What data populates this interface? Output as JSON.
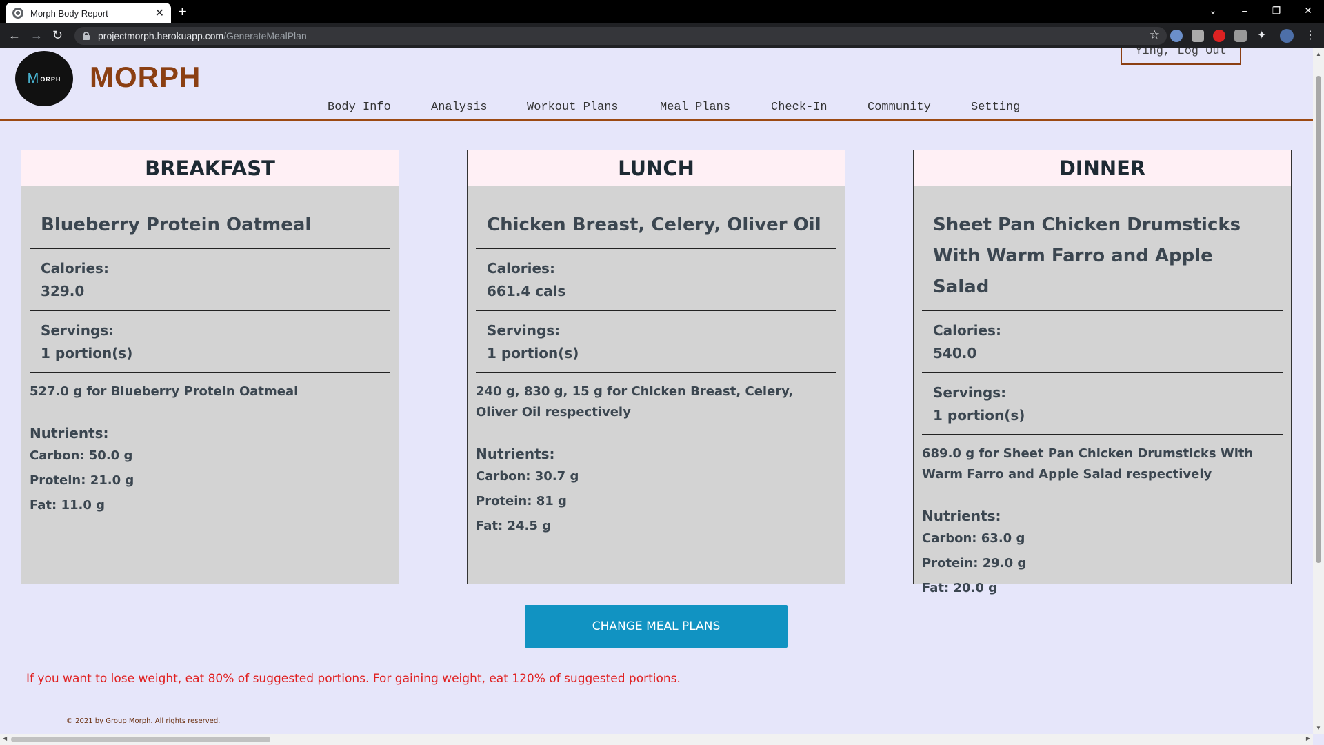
{
  "browser": {
    "tab_title": "Morph Body Report",
    "tab_close": "✕",
    "new_tab": "+",
    "url_host": "projectmorph.herokuapp.com",
    "url_path": "/GenerateMealPlan",
    "back": "←",
    "forward": "→",
    "reload": "↻",
    "star": "☆",
    "win_dropdown": "⌄",
    "win_minimize": "–",
    "win_restore": "❐",
    "win_close": "✕"
  },
  "header": {
    "logo_m": "M",
    "logo_rest": "ORPH",
    "brand": "MORPH",
    "logout": "Ying, Log Out",
    "menu": [
      "Body Info",
      "Analysis",
      "Workout Plans",
      "Meal Plans",
      "Check-In",
      "Community",
      "Setting"
    ]
  },
  "meals": [
    {
      "title": "BREAKFAST",
      "dish": "Blueberry Protein Oatmeal",
      "calories_label": "Calories:",
      "calories": "329.0",
      "servings_label": "Servings:",
      "servings": "1 portion(s)",
      "amount": "527.0 g for Blueberry Protein Oatmeal",
      "nutrients_label": "Nutrients:",
      "carbon": "Carbon: 50.0 g",
      "protein": "Protein: 21.0 g",
      "fat": "Fat: 11.0 g"
    },
    {
      "title": "LUNCH",
      "dish": "Chicken Breast, Celery, Oliver Oil",
      "calories_label": "Calories:",
      "calories": "661.4 cals",
      "servings_label": "Servings:",
      "servings": "1 portion(s)",
      "amount": "240 g, 830 g, 15 g for Chicken Breast, Celery, Oliver Oil respectively",
      "nutrients_label": "Nutrients:",
      "carbon": "Carbon: 30.7 g",
      "protein": "Protein: 81 g",
      "fat": "Fat: 24.5 g"
    },
    {
      "title": "DINNER",
      "dish": "Sheet Pan Chicken Drumsticks With Warm Farro and Apple Salad",
      "calories_label": "Calories:",
      "calories": "540.0",
      "servings_label": "Servings:",
      "servings": "1 portion(s)",
      "amount": "689.0 g for Sheet Pan Chicken Drumsticks With Warm Farro and Apple Salad respectively",
      "nutrients_label": "Nutrients:",
      "carbon": "Carbon: 63.0 g",
      "protein": "Protein: 29.0 g",
      "fat": "Fat: 20.0 g"
    }
  ],
  "change_button": "CHANGE MEAL PLANS",
  "tip": "If you want to lose weight, eat 80% of suggested portions. For gaining weight, eat 120% of suggested portions.",
  "footer": "© 2021 by Group Morph. All rights reserved.",
  "colors": {
    "page_bg": "#e6e6fa",
    "brand": "#8b3f12",
    "card_bg": "#d3d3d3",
    "card_head_bg": "#fff0f5",
    "button": "#1193c2",
    "tip": "#e02020"
  }
}
